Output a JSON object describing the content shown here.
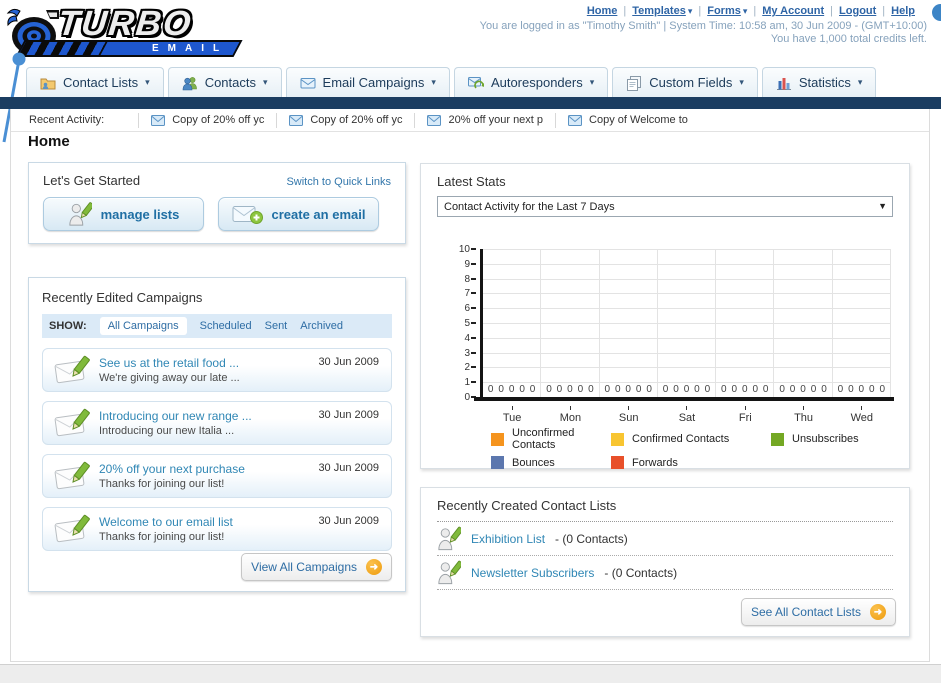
{
  "header": {
    "nav_links": [
      {
        "label": "Home",
        "dropdown": false
      },
      {
        "label": "Templates",
        "dropdown": true
      },
      {
        "label": "Forms",
        "dropdown": true
      },
      {
        "label": "My Account",
        "dropdown": false
      },
      {
        "label": "Logout",
        "dropdown": false
      },
      {
        "label": "Help",
        "dropdown": false
      }
    ],
    "link_separator": "|",
    "login_text": "You are logged in as \"Timothy Smith\" | System Time: 10:58 am, 30 Jun 2009 - (GMT+10:00)",
    "credits_text": "You have 1,000 total credits left.",
    "logo": {
      "word1": "TURBO",
      "word2": "EMAIL"
    }
  },
  "nav_tabs": [
    {
      "label": "Contact Lists"
    },
    {
      "label": "Contacts"
    },
    {
      "label": "Email Campaigns"
    },
    {
      "label": "Autoresponders"
    },
    {
      "label": "Custom Fields"
    },
    {
      "label": "Statistics"
    }
  ],
  "recent_activity": {
    "label": "Recent Activity:",
    "items": [
      "Copy of 20% off yc",
      "Copy of 20% off yc",
      "20% off your next p",
      "Copy of Welcome to"
    ]
  },
  "page": {
    "title": "Home"
  },
  "get_started": {
    "title": "Let's Get Started",
    "switch_link": "Switch to Quick Links",
    "manage_lists_label": "manage lists",
    "create_email_label": "create an email"
  },
  "campaigns": {
    "title": "Recently Edited Campaigns",
    "show_label": "SHOW:",
    "filters": [
      "All Campaigns",
      "Scheduled",
      "Sent",
      "Archived"
    ],
    "active_filter": "All Campaigns",
    "items": [
      {
        "title": "See us at the retail food ...",
        "subtitle": "We're giving away our late ...",
        "date": "30 Jun 2009"
      },
      {
        "title": "Introducing our new range ...",
        "subtitle": "Introducing our new Italia ...",
        "date": "30 Jun 2009"
      },
      {
        "title": "20% off your next purchase",
        "subtitle": "Thanks for joining our list!",
        "date": "30 Jun 2009"
      },
      {
        "title": "Welcome to our email list",
        "subtitle": "Thanks for joining our list!",
        "date": "30 Jun 2009"
      }
    ],
    "view_all_label": "View All Campaigns"
  },
  "stats": {
    "title": "Latest Stats",
    "period_selected": "Contact Activity for the Last 7 Days"
  },
  "chart_data": {
    "type": "bar",
    "title": "Contact Activity for the Last 7 Days",
    "categories": [
      "Tue",
      "Mon",
      "Sun",
      "Sat",
      "Fri",
      "Thu",
      "Wed"
    ],
    "series": [
      {
        "name": "Unconfirmed Contacts",
        "color": "#F5941E",
        "values": [
          0,
          0,
          0,
          0,
          0,
          0,
          0
        ]
      },
      {
        "name": "Confirmed Contacts",
        "color": "#F8C531",
        "values": [
          0,
          0,
          0,
          0,
          0,
          0,
          0
        ]
      },
      {
        "name": "Unsubscribes",
        "color": "#74A824",
        "values": [
          0,
          0,
          0,
          0,
          0,
          0,
          0
        ]
      },
      {
        "name": "Bounces",
        "color": "#5C77AE",
        "values": [
          0,
          0,
          0,
          0,
          0,
          0,
          0
        ]
      },
      {
        "name": "Forwards",
        "color": "#E8502A",
        "values": [
          0,
          0,
          0,
          0,
          0,
          0,
          0
        ]
      }
    ],
    "ylim": [
      0,
      10
    ],
    "ytick_step": 1,
    "grid": true,
    "value_labels": true,
    "legend_position": "bottom"
  },
  "contact_lists": {
    "title": "Recently Created Contact Lists",
    "items": [
      {
        "name": "Exhibition List",
        "detail": "- (0 Contacts)"
      },
      {
        "name": "Newsletter Subscribers",
        "detail": "- (0 Contacts)"
      }
    ],
    "see_all_label": "See All Contact Lists"
  },
  "icons": {
    "dropdown_caret": "▾",
    "select_caret": "▼",
    "arrow_forward": "➜"
  },
  "theme": {
    "navy": "#1B3D61",
    "link_blue": "#2E6DA4",
    "teal_link": "#3087B5",
    "accent_orange": "#EE9B0C",
    "muted_login_text": "#86A2BC",
    "banner_blue": "#1E57CE"
  }
}
